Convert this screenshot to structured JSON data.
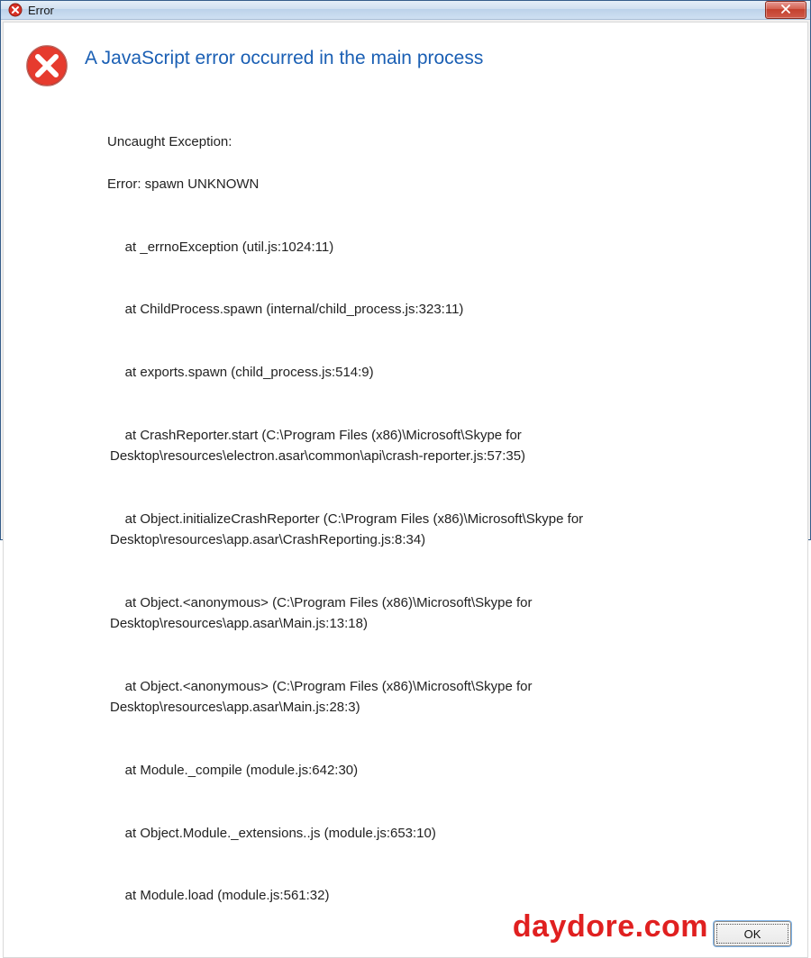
{
  "titlebar": {
    "title": "Error"
  },
  "dialog": {
    "heading": "A JavaScript error occurred in the main process",
    "lines": [
      "Uncaught Exception:",
      "Error: spawn UNKNOWN",
      "    at _errnoException (util.js:1024:11)",
      "    at ChildProcess.spawn (internal/child_process.js:323:11)",
      "    at exports.spawn (child_process.js:514:9)",
      "    at CrashReporter.start (C:\\Program Files (x86)\\Microsoft\\Skype for Desktop\\resources\\electron.asar\\common\\api\\crash-reporter.js:57:35)",
      "    at Object.initializeCrashReporter (C:\\Program Files (x86)\\Microsoft\\Skype for Desktop\\resources\\app.asar\\CrashReporting.js:8:34)",
      "    at Object.<anonymous> (C:\\Program Files (x86)\\Microsoft\\Skype for Desktop\\resources\\app.asar\\Main.js:13:18)",
      "    at Object.<anonymous> (C:\\Program Files (x86)\\Microsoft\\Skype for Desktop\\resources\\app.asar\\Main.js:28:3)",
      "    at Module._compile (module.js:642:30)",
      "    at Object.Module._extensions..js (module.js:653:10)",
      "    at Module.load (module.js:561:32)"
    ],
    "ok_label": "OK"
  },
  "watermark": "daydore.com"
}
